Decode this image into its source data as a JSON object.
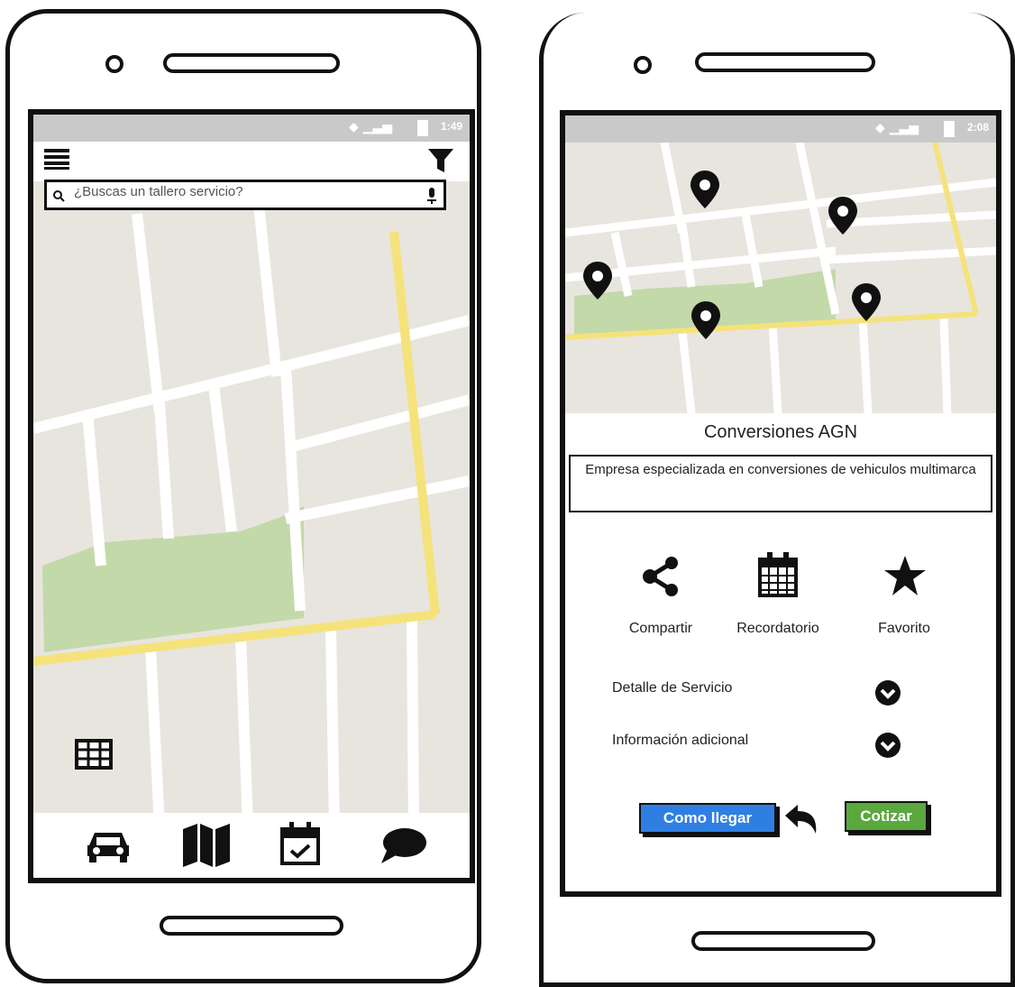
{
  "phone1": {
    "status_time": "1:49",
    "search": {
      "placeholder": "¿Buscas un tallero servicio?"
    },
    "icons": {
      "menu": "hamburger-menu-icon",
      "filter": "filter-icon",
      "search": "search-icon",
      "mic": "microphone-icon",
      "grid": "grid-icon"
    },
    "bottom_nav": [
      "car-icon",
      "map-icon",
      "calendar-check-icon",
      "chat-bubble-icon"
    ]
  },
  "phone2": {
    "status_time": "2:08",
    "business_name": "Conversiones AGN",
    "description": "Empresa especializada en conversiones de vehiculos multimarca",
    "actions": [
      {
        "icon": "share-icon",
        "label": "Compartir"
      },
      {
        "icon": "calendar-icon",
        "label": "Recordatorio"
      },
      {
        "icon": "star-icon",
        "label": "Favorito"
      }
    ],
    "sections": [
      {
        "label": "Detalle de Servicio"
      },
      {
        "label": "Información adicional"
      }
    ],
    "buttons": {
      "directions": "Como llegar",
      "quote": "Cotizar"
    }
  },
  "colors": {
    "map_bg": "#e8e5df",
    "road": "#ffffff",
    "highway": "#f5e27a",
    "park": "#c3d9a9",
    "blue_button": "#2f7fe3",
    "green_button": "#5aa83e",
    "status_bar": "#c9c9c9"
  }
}
